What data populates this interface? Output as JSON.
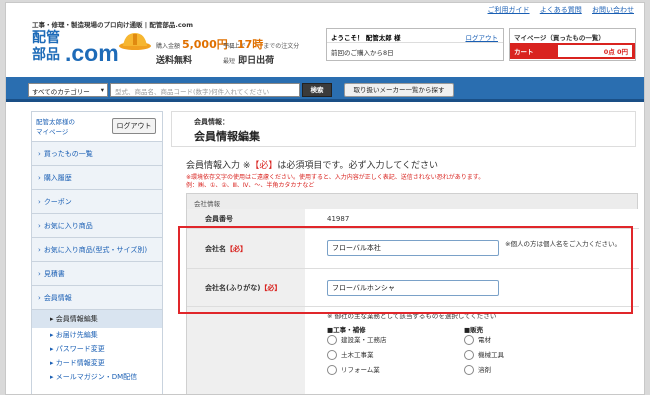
{
  "header": {
    "toplinks": [
      "ご利用ガイド",
      "よくある質問",
      "お問い合わせ"
    ],
    "tagline": "工事・修理・製造現場のプロ向け通販 | 配管部品.com",
    "logo_kanji_1": "配管",
    "logo_kanji_2": "部品",
    "logo_com": ".com",
    "ship_free_prefix": "購入金額",
    "ship_free_amount": "5,000円",
    "ship_free_suffix": "以上で",
    "ship_free_label": "送料無料",
    "ship_same_prefix": "平日",
    "ship_same_time": "17時",
    "ship_same_suffix": "までの注文分",
    "ship_same_sub_prefix": "最短",
    "ship_same_label": "即日出荷"
  },
  "userbox": {
    "greeting": "ようこそ！ 配管太郎 様",
    "logout": "ログアウト",
    "last_visit": "前回のご購入から8日"
  },
  "mypage": {
    "title": "マイページ（買ったもの一覧）",
    "cart_label": "カート",
    "cart_value": "0点 0円"
  },
  "search": {
    "category": "すべてのカテゴリー",
    "placeholder": "型式、商品名、商品コード(数字)何件入れてください",
    "button": "検索",
    "maker_button": "取り扱いメーカー一覧から探す"
  },
  "sidebar": {
    "user_line1": "配管太郎様の",
    "user_line2": "マイページ",
    "logout": "ログアウト",
    "items": [
      {
        "label": "買ったもの一覧"
      },
      {
        "label": "購入履歴"
      },
      {
        "label": "クーポン"
      },
      {
        "label": "お気に入り商品"
      },
      {
        "label": "お気に入り商品(型式・サイズ別)"
      },
      {
        "label": "見積書"
      },
      {
        "label": "会員情報"
      }
    ],
    "subitems": [
      {
        "label": "会員情報編集"
      },
      {
        "label": "お届け先編集"
      },
      {
        "label": "パスワード変更"
      },
      {
        "label": "カード情報変更"
      },
      {
        "label": "メールマガジン・DM配信"
      }
    ]
  },
  "main": {
    "breadcrumb_small": "会員情報：",
    "title": "会員情報編集",
    "required_prefix": "会員情報入力 ※",
    "required_mark": "【必】",
    "required_suffix": "は必須項目です。必ず入力してください",
    "warning_line1": "※環境依存文字の使用はご遠慮ください。使用すると、入力内容が正しく表記、送信されない恐れがあります。",
    "warning_line2": "例：㈱、①、②、Ⅲ、Ⅳ、～、半角カタカナなど",
    "section_label": "会社情報",
    "member_no_label": "会員番号",
    "member_no_value": "41987",
    "company_label": "会社名",
    "company_req": "【必】",
    "company_value": "フローバル本社",
    "company_note": "※個人の方は個人名をご入力ください。",
    "company_kana_label": "会社名(ふりがな)",
    "company_kana_req": "【必】",
    "company_kana_value": "フローバルホンシャ",
    "business_note": "※ 御社の主な業務として該当するものを選択してください",
    "group1_title": "■工事・補修",
    "group1_options": [
      "建設業・工務店",
      "土木工事業",
      "リフォーム業"
    ],
    "group2_title": "■販売",
    "group2_options": [
      "電材",
      "機械工具",
      "溶剤"
    ]
  },
  "colors": {
    "brand_blue": "#2a6eb0",
    "cart_red": "#d9231f",
    "highlight_red": "#e0262a"
  }
}
